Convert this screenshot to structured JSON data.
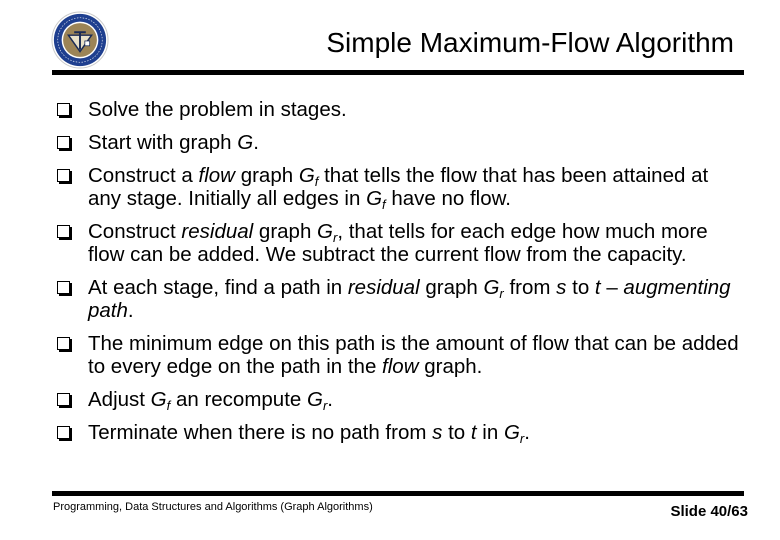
{
  "slide": {
    "title": "Simple Maximum-Flow Algorithm",
    "logo": "university-seal-icon",
    "bullets": [
      [
        {
          "t": "Solve the problem in stages."
        }
      ],
      [
        {
          "t": "Start with graph "
        },
        {
          "t": "G",
          "i": true
        },
        {
          "t": "."
        }
      ],
      [
        {
          "t": "Construct a "
        },
        {
          "t": "flow",
          "i": true
        },
        {
          "t": " graph "
        },
        {
          "t": "G",
          "i": true
        },
        {
          "t": "f",
          "sub": true
        },
        {
          "t": " that tells the flow that has been attained at any stage. Initially all edges in "
        },
        {
          "t": "G",
          "i": true
        },
        {
          "t": "f",
          "sub": true
        },
        {
          "t": " have no flow."
        }
      ],
      [
        {
          "t": "Construct "
        },
        {
          "t": "residual",
          "i": true
        },
        {
          "t": " graph "
        },
        {
          "t": "G",
          "i": true
        },
        {
          "t": "r",
          "sub": true
        },
        {
          "t": ", that tells for each edge how much more flow can be added. We subtract the current flow from the capacity."
        }
      ],
      [
        {
          "t": "At each stage, find a path in "
        },
        {
          "t": "residual",
          "i": true
        },
        {
          "t": " graph "
        },
        {
          "t": "G",
          "i": true
        },
        {
          "t": "r",
          "sub": true
        },
        {
          "t": " from "
        },
        {
          "t": "s",
          "i": true
        },
        {
          "t": " to "
        },
        {
          "t": "t",
          "i": true
        },
        {
          "t": " – "
        },
        {
          "t": "augmenting path",
          "i": true
        },
        {
          "t": "."
        }
      ],
      [
        {
          "t": "The minimum edge on this path is the amount of flow that can be added to every edge on the path in the "
        },
        {
          "t": "flow",
          "i": true
        },
        {
          "t": " graph."
        }
      ],
      [
        {
          "t": "Adjust "
        },
        {
          "t": "G",
          "i": true
        },
        {
          "t": "f",
          "sub": true
        },
        {
          "t": " an recompute "
        },
        {
          "t": "G",
          "i": true
        },
        {
          "t": "r",
          "sub": true
        },
        {
          "t": "."
        }
      ],
      [
        {
          "t": "Terminate when there is no path from "
        },
        {
          "t": "s",
          "i": true
        },
        {
          "t": " to "
        },
        {
          "t": "t",
          "i": true
        },
        {
          "t": " in "
        },
        {
          "t": "G",
          "i": true
        },
        {
          "t": "r",
          "sub": true
        },
        {
          "t": "."
        }
      ]
    ]
  },
  "footer": {
    "course": "Programming, Data Structures and Algorithms  (Graph Algorithms)",
    "slide_number": "Slide 40/63"
  },
  "colors": {
    "seal_ring": "#1f3f8f",
    "seal_inner": "#9c8457"
  }
}
